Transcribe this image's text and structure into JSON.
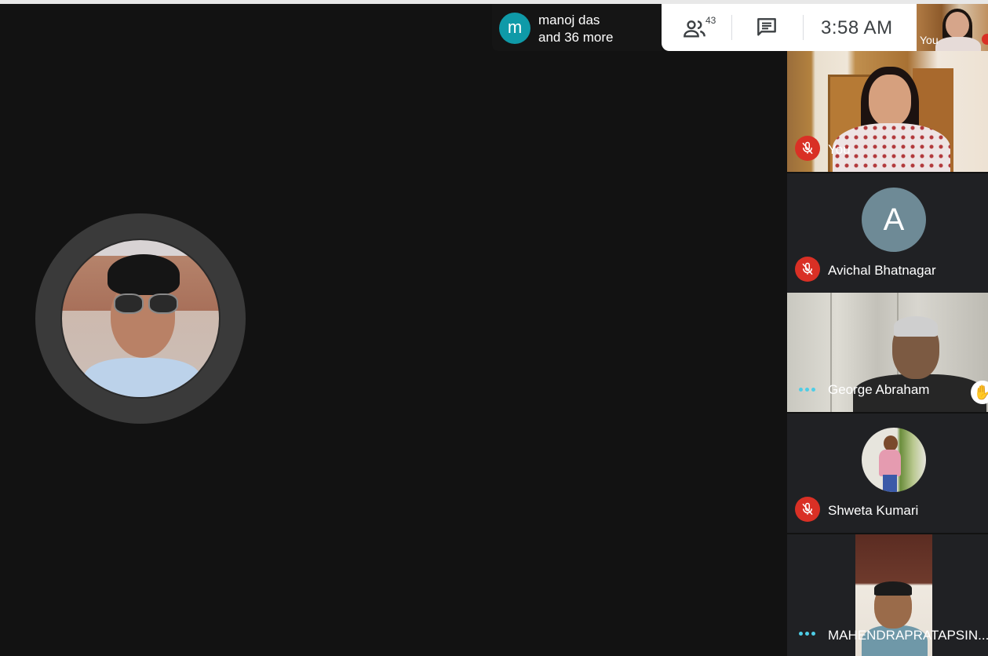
{
  "presenter": {
    "avatar_letter": "m",
    "name": "manoj das",
    "more": "and 36 more"
  },
  "controls": {
    "people_count": "43",
    "time": "3:58 AM"
  },
  "self_thumb": {
    "label": "You"
  },
  "tiles": [
    {
      "name": "You",
      "status": "muted"
    },
    {
      "name": "Avichal Bhatnagar",
      "avatar_letter": "A",
      "status": "muted"
    },
    {
      "name": "George Abraham",
      "status": "hand-raised"
    },
    {
      "name": "Shweta Kumari",
      "status": "muted"
    },
    {
      "name": "MAHENDRAPRATAPSIN...",
      "status": "speaking"
    }
  ],
  "colors": {
    "background": "#121212",
    "tile": "#202124",
    "mic_off": "#d93025",
    "presenter_avatar": "#0f9aa8",
    "letter_avatar": "#6e8a96",
    "dots": "#4ecde6"
  }
}
